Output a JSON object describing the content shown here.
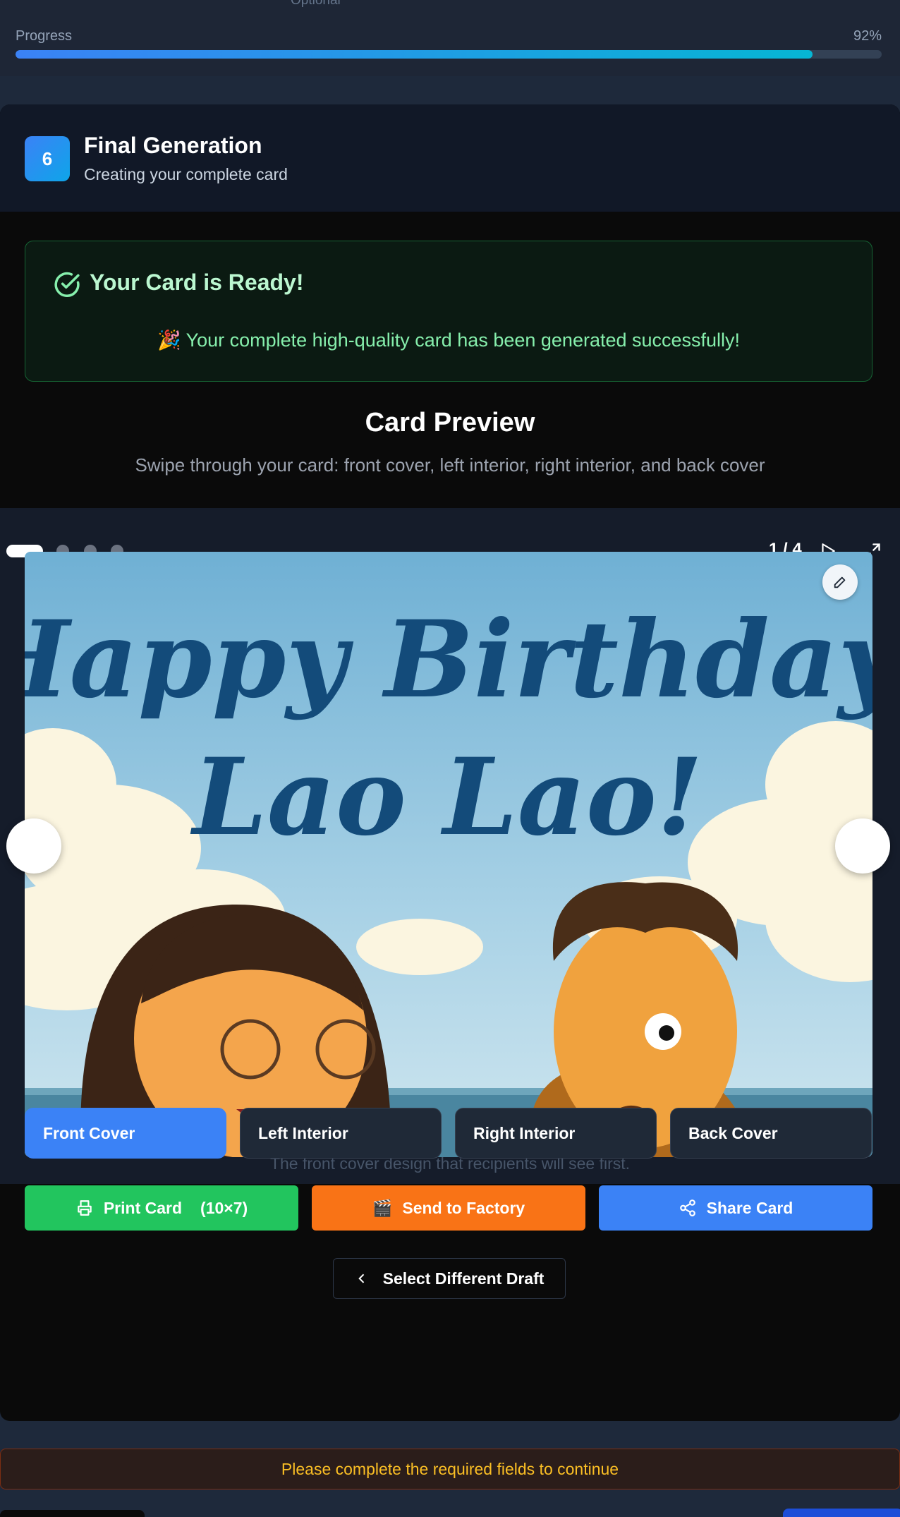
{
  "progress": {
    "optional_label": "Optional",
    "label": "Progress",
    "percent_text": "92%",
    "value": 0.92
  },
  "step": {
    "number": "6",
    "title": "Final Generation",
    "subtitle": "Creating your complete card"
  },
  "ready": {
    "title": "Your Card is Ready!",
    "message": "🎉 Your complete high-quality card has been generated successfully!",
    "icon": "check-circle-icon"
  },
  "preview": {
    "title": "Card Preview",
    "subtitle": "Swipe through your card: front cover, left interior, right interior, and back cover",
    "counter": "1 / 4",
    "caption": "The front cover design that recipients will see first.",
    "card_text_line1": "Happy Birthday,",
    "card_text_line2": "Lao Lao!",
    "slides": 4,
    "active_slide": 1
  },
  "tabs": [
    {
      "label": "Front Cover",
      "active": true
    },
    {
      "label": "Left Interior",
      "active": false
    },
    {
      "label": "Right Interior",
      "active": false
    },
    {
      "label": "Back Cover",
      "active": false
    }
  ],
  "actions": {
    "print_label": "Print Card",
    "print_size": "(10×7)",
    "factory_emoji": "🎬",
    "factory_label": "Send to Factory",
    "share_label": "Share Card"
  },
  "back_label": "Select Different Draft",
  "warning": "Please complete the required fields to continue",
  "colors": {
    "accent": "#3b82f6",
    "success": "#22c55e",
    "factory": "#f97316",
    "warning_text": "#fbbf24"
  }
}
